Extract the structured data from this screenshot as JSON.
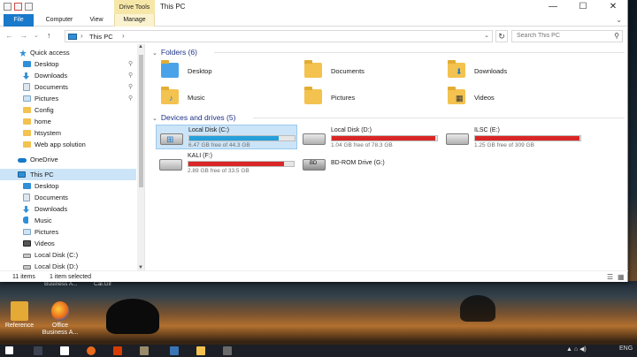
{
  "window": {
    "title": "This PC",
    "context_tab_title": "Drive Tools",
    "controls": {
      "minimize": "—",
      "maximize": "☐",
      "close": "✕"
    }
  },
  "ribbon": {
    "tabs": [
      "File",
      "Computer",
      "View",
      "Manage"
    ],
    "toggle": "⌄"
  },
  "address": {
    "back": "←",
    "forward": "→",
    "recent": "⌄",
    "up": "↑",
    "path_sep": "›",
    "crumb": "This PC",
    "crumb_sep": "›",
    "dropdown": "⌄",
    "refresh": "↻",
    "search_placeholder": "Search This PC",
    "search_icon": "⚲"
  },
  "nav_pane": {
    "items": [
      {
        "label": "Quick access",
        "icon": "star-icon"
      },
      {
        "label": "Desktop",
        "icon": "desktop-folder-icon",
        "pin": "⚲"
      },
      {
        "label": "Downloads",
        "icon": "downloads-folder-icon",
        "pin": "⚲"
      },
      {
        "label": "Documents",
        "icon": "documents-folder-icon",
        "pin": "⚲"
      },
      {
        "label": "Pictures",
        "icon": "pictures-folder-icon",
        "pin": "⚲"
      },
      {
        "label": "Config",
        "icon": "folder-icon"
      },
      {
        "label": "home",
        "icon": "folder-icon"
      },
      {
        "label": "htsystem",
        "icon": "folder-icon"
      },
      {
        "label": "Web app solution",
        "icon": "folder-icon"
      },
      {
        "label": "OneDrive",
        "icon": "cloud-icon"
      },
      {
        "label": "This PC",
        "icon": "computer-icon"
      },
      {
        "label": "Desktop",
        "icon": "desktop-folder-icon"
      },
      {
        "label": "Documents",
        "icon": "documents-folder-icon"
      },
      {
        "label": "Downloads",
        "icon": "downloads-folder-icon"
      },
      {
        "label": "Music",
        "icon": "music-folder-icon"
      },
      {
        "label": "Pictures",
        "icon": "pictures-folder-icon"
      },
      {
        "label": "Videos",
        "icon": "videos-folder-icon"
      },
      {
        "label": "Local Disk (C:)",
        "icon": "drive-icon"
      },
      {
        "label": "Local Disk (D:)",
        "icon": "drive-icon"
      }
    ],
    "scroll_up": "▲",
    "scroll_down": "▼"
  },
  "content": {
    "folders_header": "Folders (6)",
    "folders": [
      {
        "label": "Desktop",
        "icon": "desktop-folder-icon"
      },
      {
        "label": "Documents",
        "icon": "documents-folder-icon"
      },
      {
        "label": "Downloads",
        "icon": "downloads-folder-icon"
      },
      {
        "label": "Music",
        "icon": "music-folder-icon"
      },
      {
        "label": "Pictures",
        "icon": "pictures-folder-icon"
      },
      {
        "label": "Videos",
        "icon": "videos-folder-icon"
      }
    ],
    "drives_header": "Devices and drives (5)",
    "drives": [
      {
        "name": "Local Disk (C:)",
        "free": "6.47 GB free of 44.3 GB",
        "used_fraction": 0.85,
        "bar_color": "#26a0da"
      },
      {
        "name": "Local Disk (D:)",
        "free": "1.04 GB free of 78.3 GB",
        "used_fraction": 0.98,
        "bar_color": "#da2626"
      },
      {
        "name": "ILSC (E:)",
        "free": "1.25 GB free of 309 GB",
        "used_fraction": 0.99,
        "bar_color": "#da2626"
      },
      {
        "name": "KALI (F:)",
        "free": "2.89 GB free of 33.5 GB",
        "used_fraction": 0.91,
        "bar_color": "#da2626"
      },
      {
        "name": "BD-ROM Drive (G:)",
        "free": "",
        "used_fraction": null,
        "bar_color": ""
      }
    ]
  },
  "status": {
    "items_count": "11 items",
    "selected": "1 item selected",
    "details_view": "☰",
    "tiles_view": "▦"
  },
  "desktop": {
    "icons": [
      {
        "label": "Reference",
        "icon": "reference-icon"
      },
      {
        "label": "Office Business A...",
        "icon": "firefox-icon"
      }
    ],
    "faded_labels": [
      "Business A...",
      "Cal.Gif"
    ]
  },
  "taskbar": {
    "language": "ENG"
  }
}
